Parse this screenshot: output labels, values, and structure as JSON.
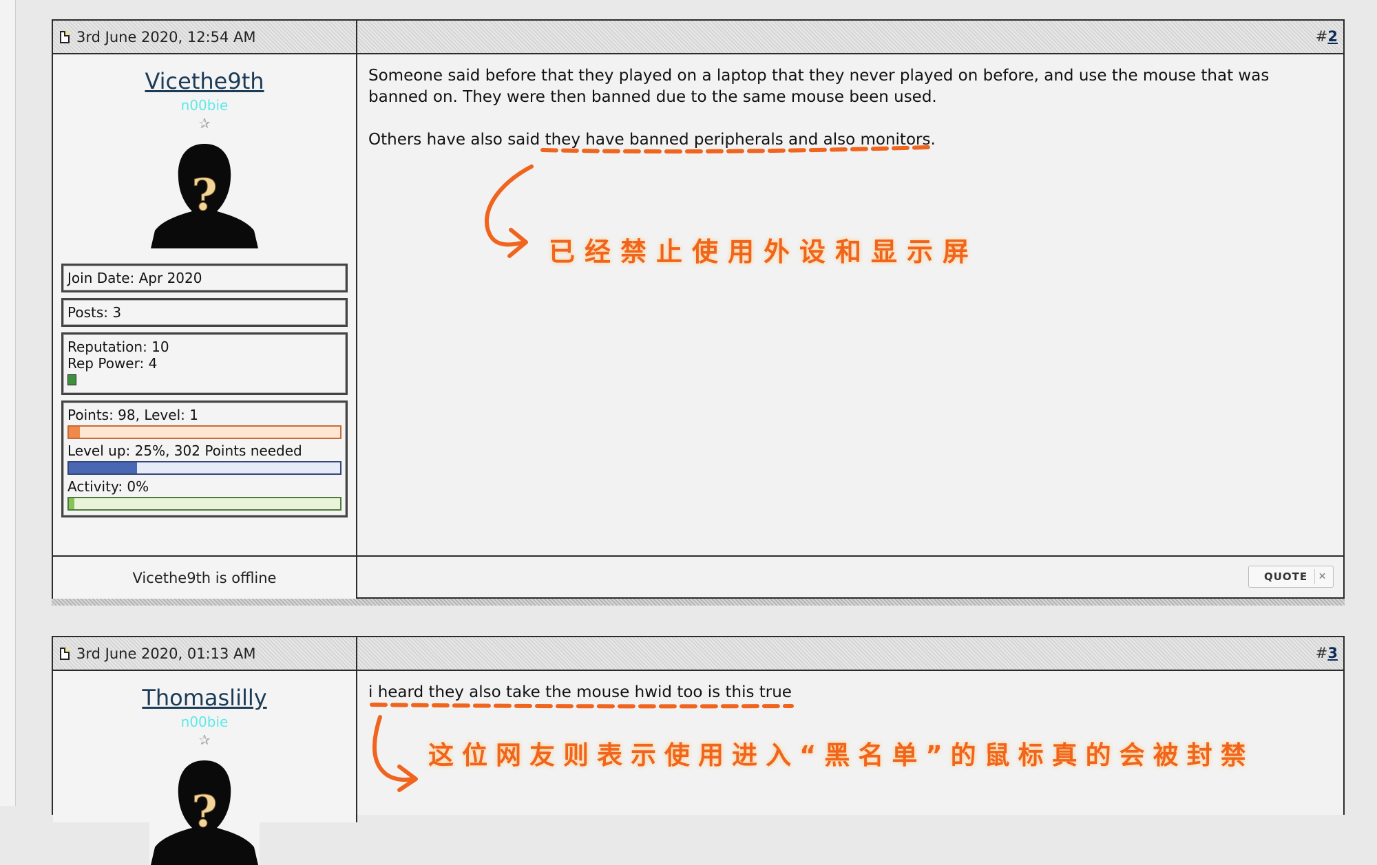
{
  "posts": [
    {
      "date": "3rd June 2020, 12:54 AM",
      "number_prefix": "#",
      "number": "2",
      "username": "Vicethe9th",
      "user_title": "n00bie",
      "join_date": "Join Date: Apr 2020",
      "posts": "Posts: 3",
      "reputation": "Reputation: 10",
      "rep_power": "Rep Power: 4",
      "points_level": "Points: 98, Level: 1",
      "points_progress": 0.04,
      "level_up": "Level up: 25%, 302 Points needed",
      "level_up_progress": 0.25,
      "activity": "Activity: 0%",
      "activity_progress": 0.02,
      "message_paragraphs": [
        "Someone said before that they played on a laptop that they never played on before, and use the mouse that was banned on. They were then banned due to the same mouse been used.",
        "Others have also said they have banned peripherals and also monitors."
      ],
      "status": "Vicethe9th is offline",
      "quote_label": "QUOTE",
      "annotation": "已经禁止使用外设和显示屏"
    },
    {
      "date": "3rd June 2020, 01:13 AM",
      "number_prefix": "#",
      "number": "3",
      "username": "Thomaslilly",
      "user_title": "n00bie",
      "message_paragraphs": [
        "i heard they also take the mouse hwid too is this true"
      ],
      "annotation": "这位网友则表示使用进入“黑名单”的鼠标真的会被封禁"
    }
  ],
  "colors": {
    "annotation": "#f0641e",
    "user_title": "#5ee8e8",
    "username": "#1c3b57"
  },
  "icons": {
    "post_icon": "document-icon",
    "star": "star-icon",
    "avatar": "unknown-user-avatar",
    "rep": "reputation-gem-icon"
  }
}
